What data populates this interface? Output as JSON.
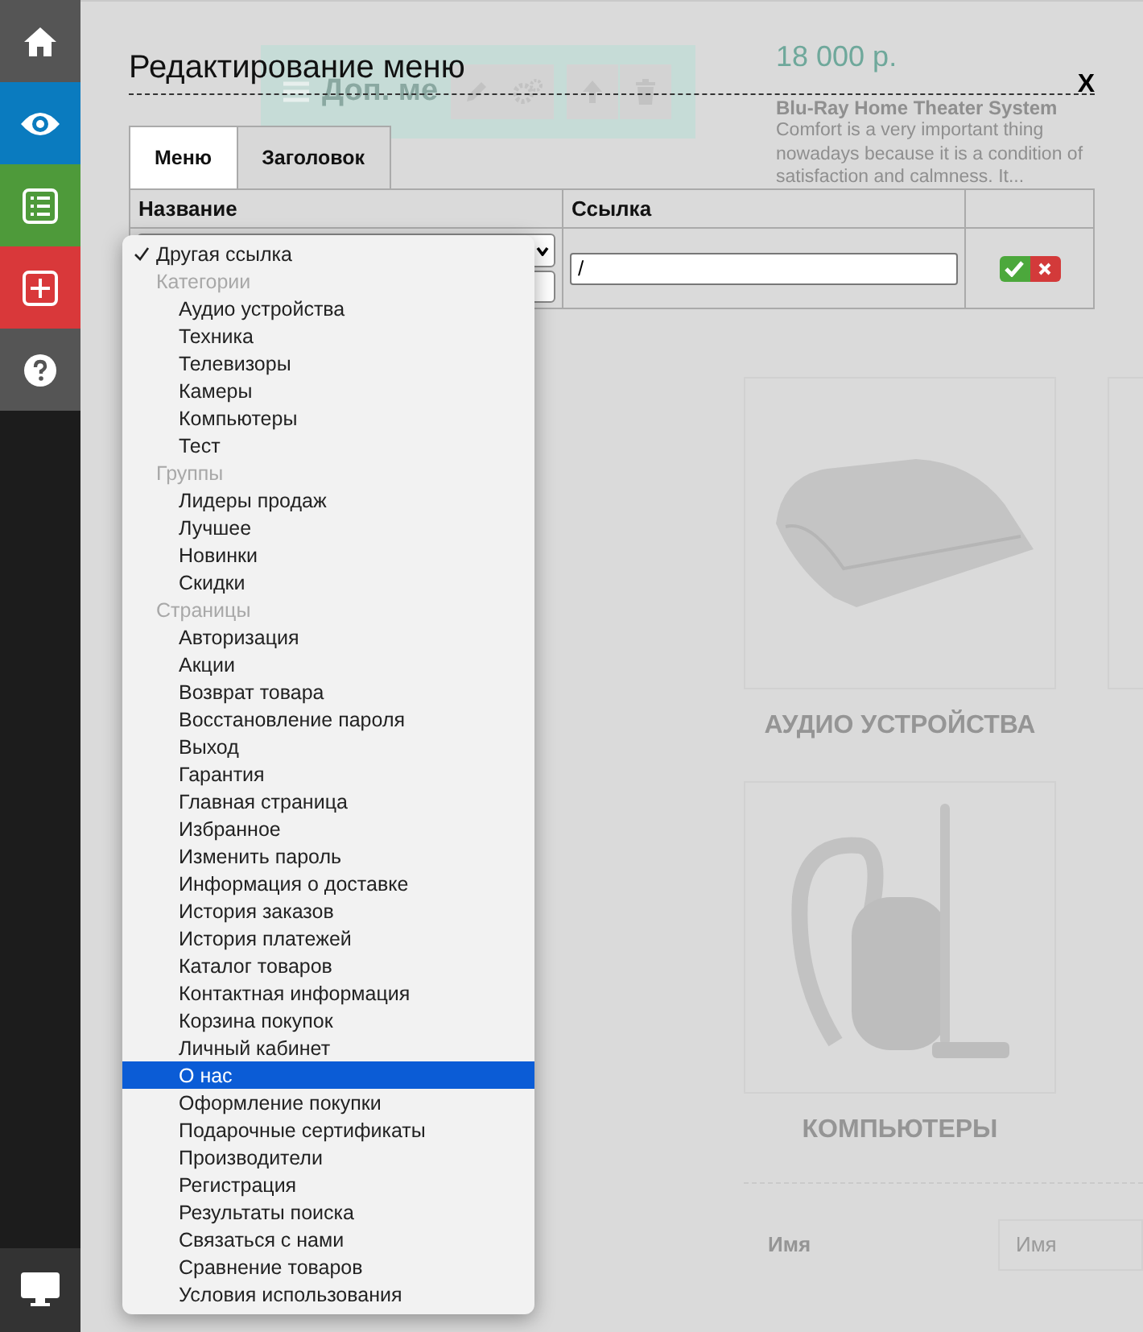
{
  "sidebar": {
    "items": [
      {
        "kind": "home",
        "color": "#555555"
      },
      {
        "kind": "view",
        "color": "#0a7bbf"
      },
      {
        "kind": "list",
        "color": "#4e9a3a"
      },
      {
        "kind": "add",
        "color": "#d9383a"
      },
      {
        "kind": "help",
        "color": "#555555"
      }
    ],
    "bottom": {
      "kind": "monitor"
    }
  },
  "page": {
    "promo": {
      "title": "Доп. ме"
    },
    "product": {
      "price": "18 000 р.",
      "name": "Blu-Ray Home Theater System",
      "description": "Comfort is a very important thing nowadays because it is a condition of satisfaction and calmness. It..."
    },
    "categories": [
      {
        "kind": "appliance",
        "title": "АУДИО УСТРОЙСТВА"
      },
      {
        "kind": "vacuum",
        "title": "КОМПЬЮТЕРЫ"
      }
    ],
    "form": {
      "label": "Имя",
      "placeholder": "Имя"
    }
  },
  "modal": {
    "title": "Редактирование меню",
    "close": "X",
    "tabs": [
      {
        "label": "Меню",
        "selected": true
      },
      {
        "label": "Заголовок",
        "selected": false
      }
    ],
    "table": {
      "columns": [
        "Название",
        "Ссылка"
      ],
      "rows": [
        {
          "link": "/"
        }
      ]
    },
    "dropdown": {
      "items": [
        {
          "kind": "option",
          "label": "Другая ссылка",
          "checked": true,
          "selected": false
        },
        {
          "kind": "group",
          "label": "Категории",
          "children": [
            {
              "label": "Аудио устройства",
              "checked": false,
              "selected": false
            },
            {
              "label": "Техника",
              "checked": false,
              "selected": false
            },
            {
              "label": "Телевизоры",
              "checked": false,
              "selected": false
            },
            {
              "label": "Камеры",
              "checked": false,
              "selected": false
            },
            {
              "label": "Компьютеры",
              "checked": false,
              "selected": false
            },
            {
              "label": "Тест",
              "checked": false,
              "selected": false
            }
          ]
        },
        {
          "kind": "group",
          "label": "Группы",
          "children": [
            {
              "label": "Лидеры продаж",
              "checked": false,
              "selected": false
            },
            {
              "label": "Лучшее",
              "checked": false,
              "selected": false
            },
            {
              "label": "Новинки",
              "checked": false,
              "selected": false
            },
            {
              "label": "Скидки",
              "checked": false,
              "selected": false
            }
          ]
        },
        {
          "kind": "group",
          "label": "Страницы",
          "children": [
            {
              "label": "Авторизация",
              "checked": false,
              "selected": false
            },
            {
              "label": "Акции",
              "checked": false,
              "selected": false
            },
            {
              "label": "Возврат товара",
              "checked": false,
              "selected": false
            },
            {
              "label": "Восстановление пароля",
              "checked": false,
              "selected": false
            },
            {
              "label": "Выход",
              "checked": false,
              "selected": false
            },
            {
              "label": "Гарантия",
              "checked": false,
              "selected": false
            },
            {
              "label": "Главная страница",
              "checked": false,
              "selected": false
            },
            {
              "label": "Избранное",
              "checked": false,
              "selected": false
            },
            {
              "label": "Изменить пароль",
              "checked": false,
              "selected": false
            },
            {
              "label": "Информация о доставке",
              "checked": false,
              "selected": false
            },
            {
              "label": "История заказов",
              "checked": false,
              "selected": false
            },
            {
              "label": "История платежей",
              "checked": false,
              "selected": false
            },
            {
              "label": "Каталог товаров",
              "checked": false,
              "selected": false
            },
            {
              "label": "Контактная информация",
              "checked": false,
              "selected": false
            },
            {
              "label": "Корзина покупок",
              "checked": false,
              "selected": false
            },
            {
              "label": "Личный кабинет",
              "checked": false,
              "selected": false
            },
            {
              "label": "О нас",
              "checked": false,
              "selected": true
            },
            {
              "label": "Оформление покупки",
              "checked": false,
              "selected": false
            },
            {
              "label": "Подарочные сертификаты",
              "checked": false,
              "selected": false
            },
            {
              "label": "Производители",
              "checked": false,
              "selected": false
            },
            {
              "label": "Регистрация",
              "checked": false,
              "selected": false
            },
            {
              "label": "Результаты поиска",
              "checked": false,
              "selected": false
            },
            {
              "label": "Связаться с нами",
              "checked": false,
              "selected": false
            },
            {
              "label": "Сравнение товаров",
              "checked": false,
              "selected": false
            },
            {
              "label": "Условия использования",
              "checked": false,
              "selected": false
            }
          ]
        }
      ]
    }
  }
}
